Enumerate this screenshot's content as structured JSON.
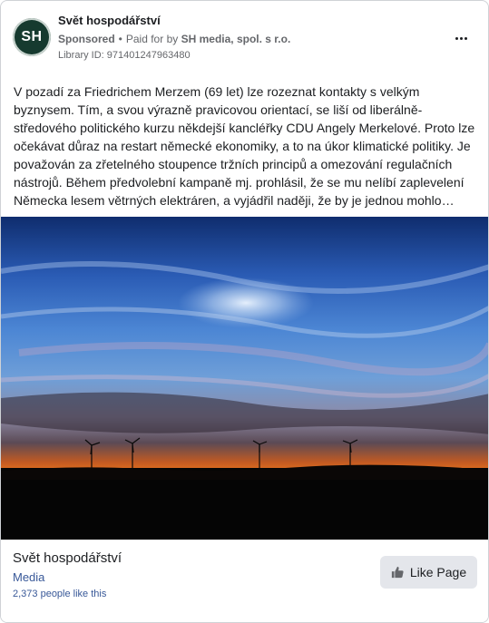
{
  "header": {
    "avatar_initials": "SH",
    "page_name": "Svět hospodářství",
    "sponsored_label": "Sponsored",
    "separator": "•",
    "paid_for_prefix": "Paid for by",
    "payer_name": "SH media, spol. s r.o.",
    "library_id": "Library ID: 971401247963480"
  },
  "post": {
    "body": "V pozadí za Friedrichem Merzem (69 let) lze rozeznat kontakty s velkým byznysem. Tím, a svou výrazně pravicovou orientací, se liší od liberálně-středového politického kurzu někdejší kancléřky CDU Angely Merkelové. Proto lze očekávat důraz na restart německé ekonomiky, a to na úkor klimatické politiky. Je považován za zřetelného stoupence tržních principů a omezování regulačních nástrojů. Během předvolební kampaně mj. prohlásil, že se mu nelíbí zaplevelení Německa lesem větrných elektráren, a vyjádřil naději, že by je jednou mohlo…"
  },
  "footer": {
    "page_name": "Svět hospodářství",
    "category": "Media",
    "likes": "2,373 people like this",
    "like_button_label": "Like Page"
  },
  "colors": {
    "avatar_bg": "#163a2f",
    "link_blue": "#385898",
    "button_bg": "#e4e6eb"
  }
}
